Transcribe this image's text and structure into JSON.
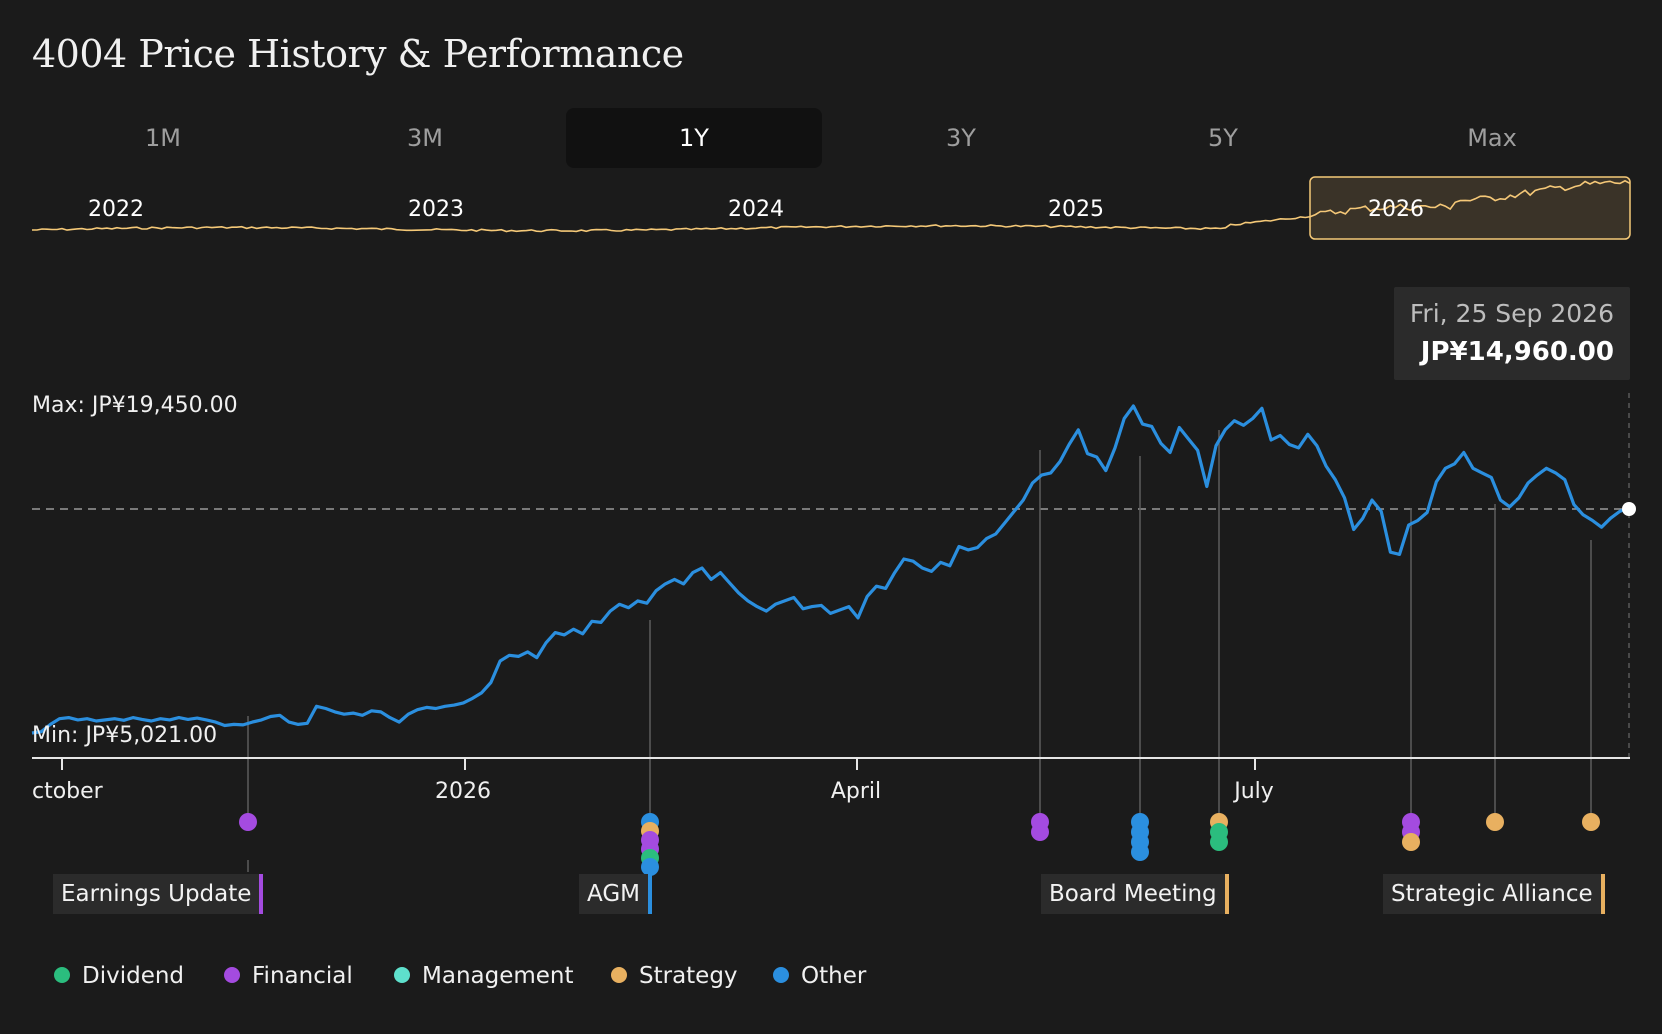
{
  "title": "4004 Price History & Performance",
  "tabs": [
    {
      "label": "1M",
      "active": false
    },
    {
      "label": "3M",
      "active": false
    },
    {
      "label": "1Y",
      "active": true
    },
    {
      "label": "3Y",
      "active": false
    },
    {
      "label": "5Y",
      "active": false
    },
    {
      "label": "Max",
      "active": false
    }
  ],
  "navigator": {
    "year_labels": [
      "2022",
      "2023",
      "2024",
      "2025",
      "2026"
    ],
    "line_color": "#f5c978",
    "selection_color": "#f5c978"
  },
  "tooltip": {
    "date": "Fri, 25 Sep 2026",
    "price": "JP¥14,960.00"
  },
  "chart_data": {
    "type": "line",
    "line_color": "#2b8fdf",
    "max_label": "Max: JP¥19,450.00",
    "min_label": "Min: JP¥5,021.00",
    "y_max": 19450,
    "y_min": 5021,
    "current_value": 14960,
    "x_tick_labels": [
      "ctober",
      "2026",
      "April",
      "July"
    ],
    "series": [
      {
        "values": [
          5021,
          5080,
          5400,
          5650,
          5700,
          5600,
          5650,
          5550,
          5600,
          5650,
          5580,
          5700,
          5620,
          5550,
          5650,
          5600,
          5700,
          5620,
          5680,
          5600,
          5500,
          5350,
          5400,
          5380,
          5500,
          5600,
          5750,
          5800,
          5500,
          5400,
          5450,
          6200,
          6100,
          5950,
          5850,
          5900,
          5800,
          6000,
          5950,
          5700,
          5500,
          5850,
          6050,
          6150,
          6100,
          6200,
          6250,
          6350,
          6550,
          6800,
          7250,
          8200,
          8450,
          8400,
          8600,
          8350,
          9000,
          9450,
          9350,
          9600,
          9400,
          9950,
          9900,
          10400,
          10700,
          10550,
          10850,
          10750,
          11300,
          11600,
          11800,
          11600,
          12100,
          12300,
          11800,
          12100,
          11650,
          11200,
          10850,
          10600,
          10400,
          10700,
          10850,
          11000,
          10500,
          10600,
          10650,
          10300,
          10450,
          10600,
          10100,
          11050,
          11500,
          11400,
          12100,
          12700,
          12600,
          12300,
          12150,
          12550,
          12400,
          13250,
          13100,
          13200,
          13600,
          13800,
          14300,
          14800,
          15300,
          16050,
          16400,
          16500,
          17000,
          17750,
          18400,
          17350,
          17200,
          16600,
          17600,
          18900,
          19450,
          18650,
          18550,
          17800,
          17400,
          18500,
          18000,
          17500,
          15900,
          17700,
          18400,
          18800,
          18600,
          18900,
          19350,
          17950,
          18150,
          17750,
          17600,
          18200,
          17700,
          16800,
          16200,
          15400,
          14000,
          14500,
          15300,
          14800,
          13000,
          12900,
          14200,
          14400,
          14750,
          16100,
          16700,
          16900,
          17400,
          16700,
          16500,
          16300,
          15300,
          15000,
          15400,
          16050,
          16400,
          16700,
          16500,
          16200,
          15100,
          14650,
          14400,
          14100,
          14500,
          14800,
          14960
        ],
        "color": "#2b8fdf"
      }
    ],
    "grid": false
  },
  "events": {
    "labels": [
      {
        "text": "Earnings Update",
        "color": "#a44be0"
      },
      {
        "text": "AGM",
        "color": "#2b8fdf"
      },
      {
        "text": "Board Meeting",
        "color": "#e8b060"
      },
      {
        "text": "Strategic Alliance",
        "color": "#e8b060"
      }
    ]
  },
  "legend": [
    {
      "label": "Dividend",
      "color": "#2bbd7e"
    },
    {
      "label": "Financial",
      "color": "#a44be0"
    },
    {
      "label": "Management",
      "color": "#5ee0cc"
    },
    {
      "label": "Strategy",
      "color": "#e8b060"
    },
    {
      "label": "Other",
      "color": "#2b8fdf"
    }
  ]
}
